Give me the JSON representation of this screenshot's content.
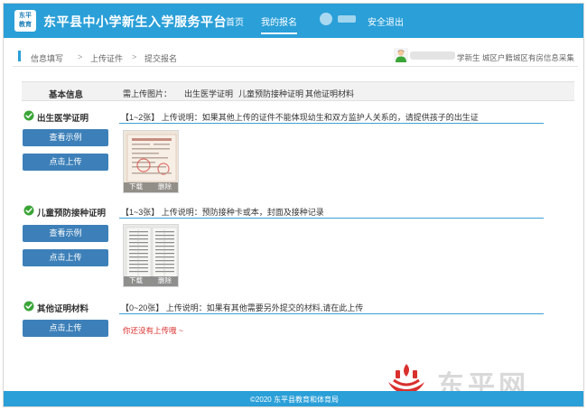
{
  "header": {
    "logo_text_top": "东平",
    "logo_text_bottom": "教育",
    "title": "东平县中小学新生入学服务平台",
    "nav": [
      {
        "label": "首页"
      },
      {
        "label": "我的报名"
      },
      {
        "label": "安全退出"
      }
    ]
  },
  "breadcrumb": {
    "items": [
      "信息填写",
      "上传证件",
      "提交报名"
    ],
    "separator": ">",
    "user_info": "学新生 城区户籍城区有房信息采集"
  },
  "basic": {
    "label": "基本信息",
    "required_label": "需上传图片：",
    "items": [
      "出生医学证明",
      "儿童预防接种证明",
      "其他证明材料"
    ]
  },
  "sections": [
    {
      "title": "出生医学证明",
      "desc": "【1~2张】 上传说明：如果其他上传的证件不能体现幼生和双方监护人关系的，请提供孩子的出生证",
      "view_label": "查看示例",
      "upload_label": "点击上传",
      "thumb_download": "下载",
      "thumb_delete": "删除"
    },
    {
      "title": "儿童预防接种证明",
      "desc": "【1~3张】 上传说明：预防接种卡或本，封面及接种记录",
      "view_label": "查看示例",
      "upload_label": "点击上传",
      "thumb_download": "下载",
      "thumb_delete": "删除"
    },
    {
      "title": "其他证明材料",
      "desc": "【0~20张】 上传说明：如果有其他需要另外提交的材料,请在此上传",
      "upload_label": "点击上传",
      "empty_message": "你还没有上传哦 ~"
    }
  ],
  "watermark": "东平网",
  "footer": "©2020 东平县教育和体育局",
  "colors": {
    "primary": "#2a9fd8",
    "button": "#3d80b9",
    "check": "#3aa537",
    "error": "#d9302e"
  }
}
